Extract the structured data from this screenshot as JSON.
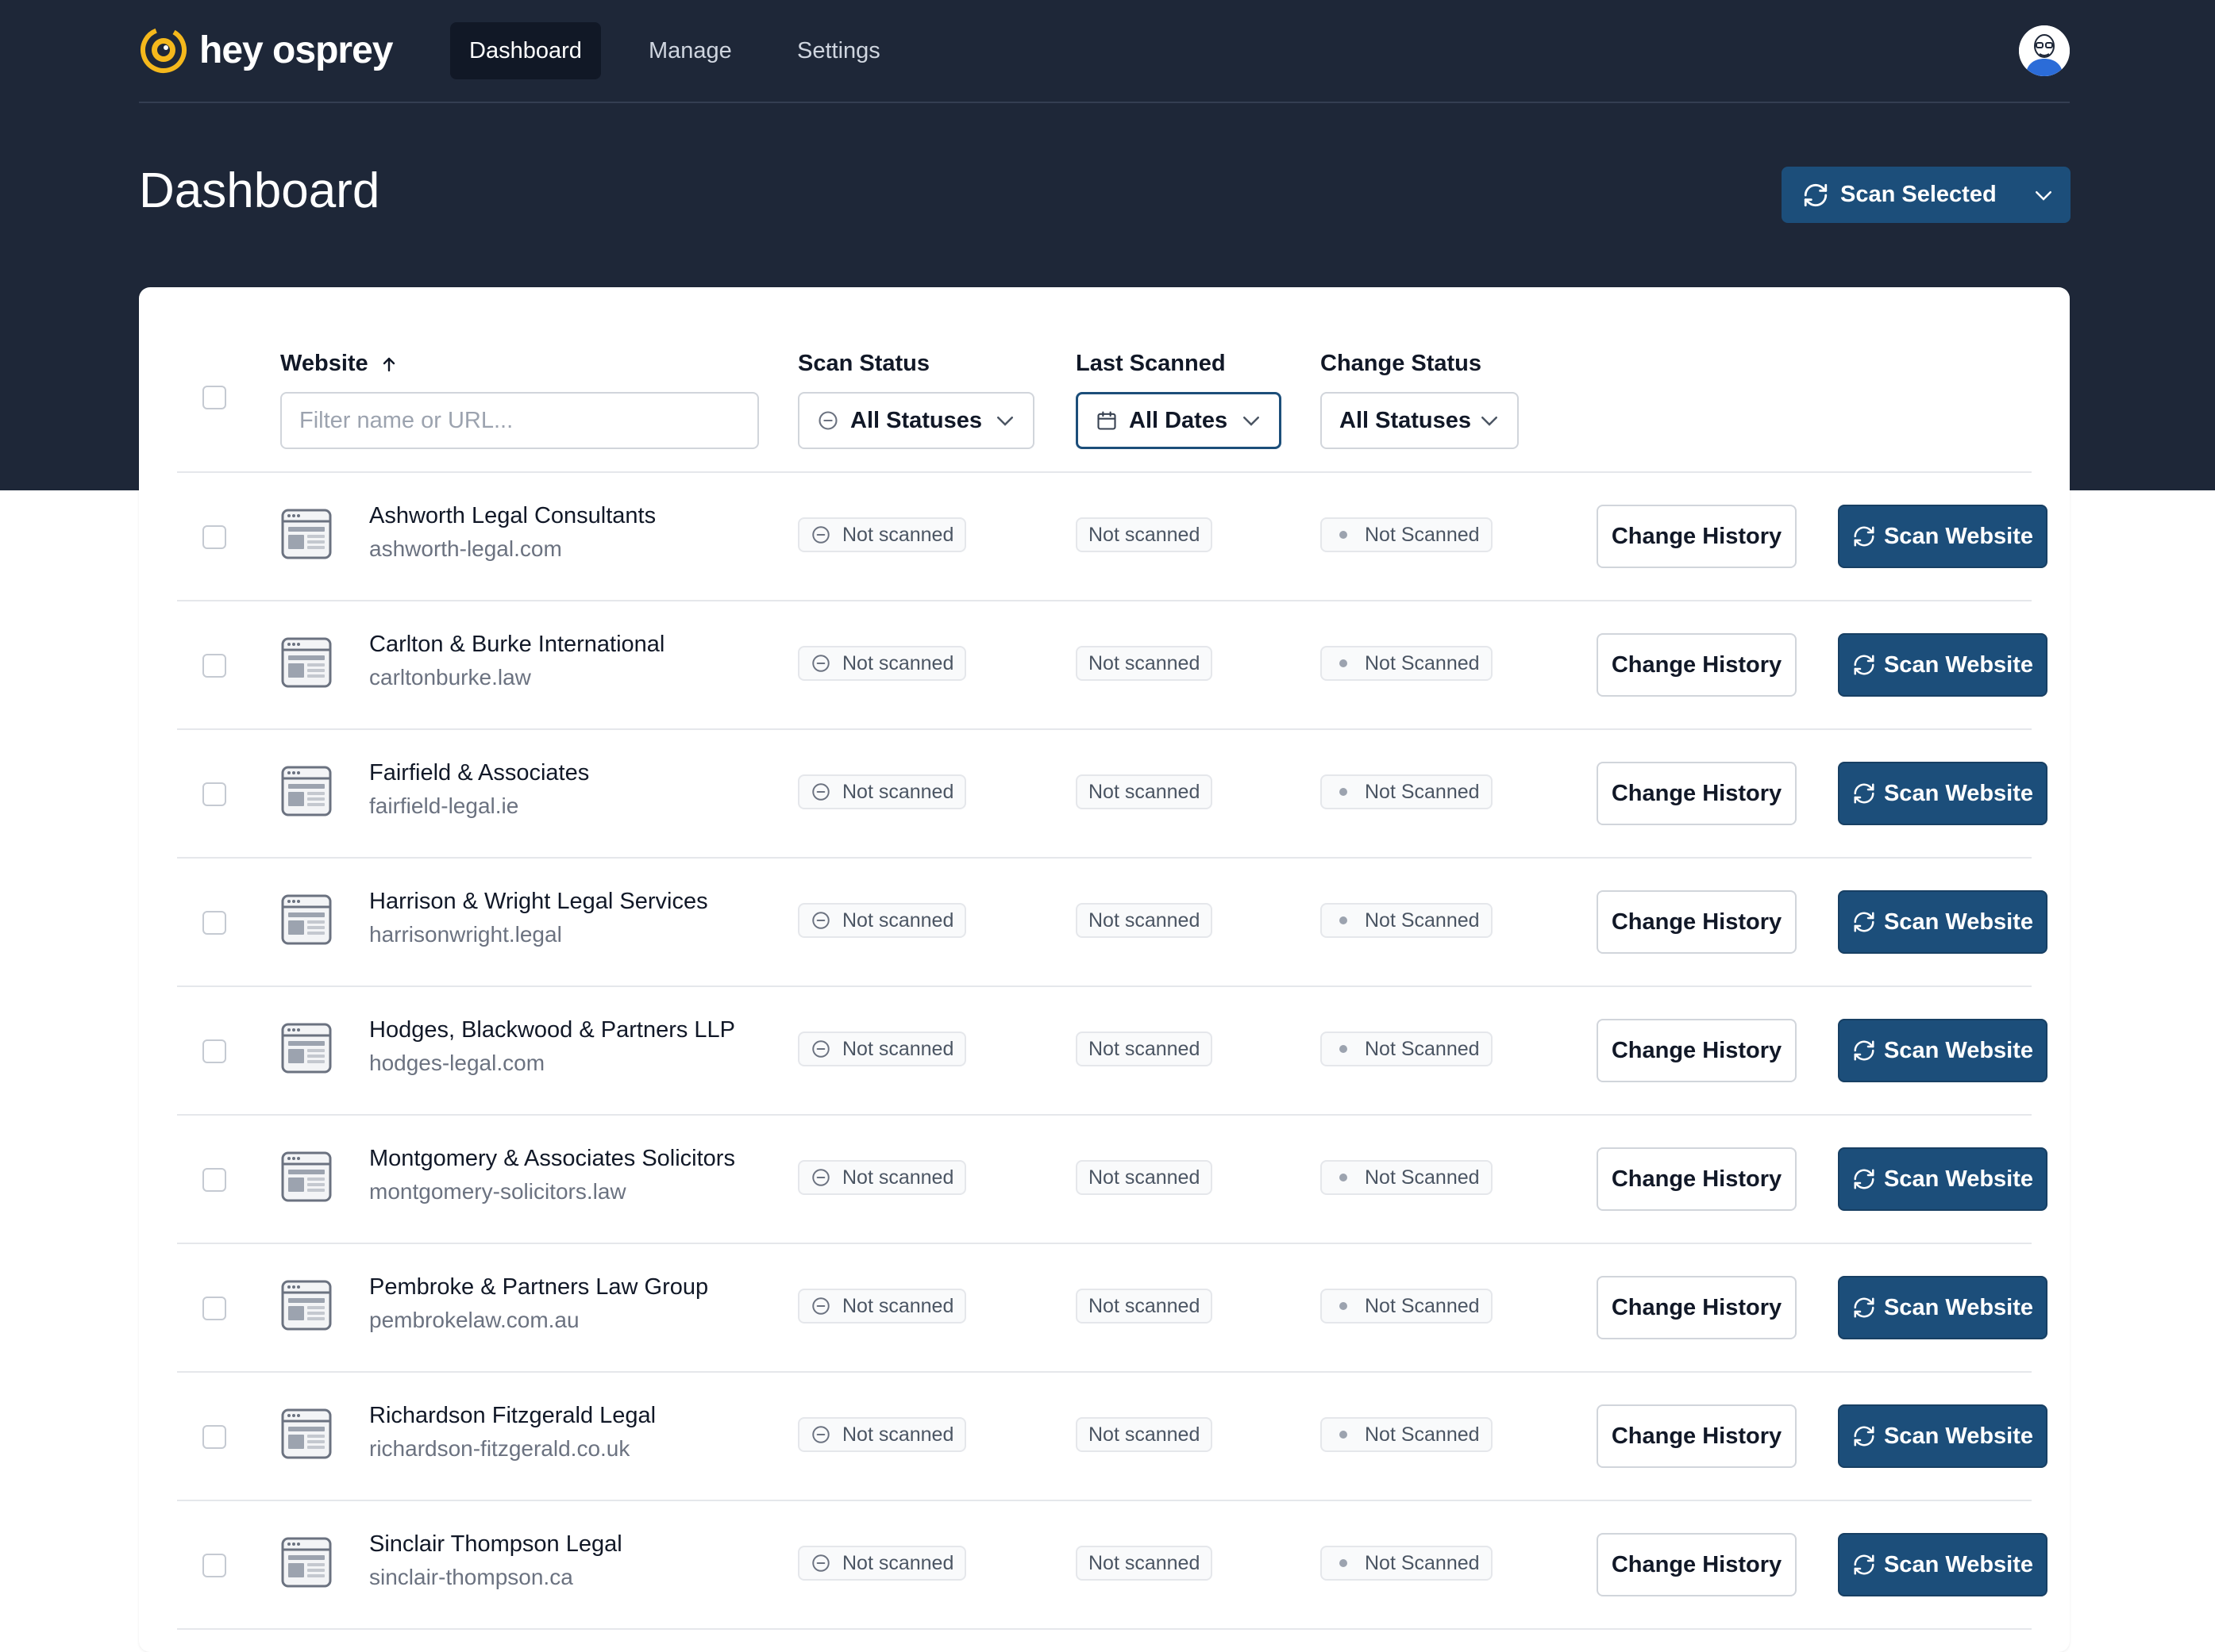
{
  "app": {
    "logo_text": "hey osprey"
  },
  "nav": {
    "items": [
      {
        "label": "Dashboard",
        "active": true
      },
      {
        "label": "Manage",
        "active": false
      },
      {
        "label": "Settings",
        "active": false
      }
    ]
  },
  "page": {
    "title": "Dashboard",
    "scan_selected_label": "Scan Selected"
  },
  "table": {
    "columns": {
      "website": "Website",
      "scan_status": "Scan Status",
      "last_scanned": "Last Scanned",
      "change_status": "Change Status"
    },
    "filters": {
      "website_placeholder": "Filter name or URL...",
      "scan_status": "All Statuses",
      "last_scanned": "All Dates",
      "change_status": "All Statuses"
    },
    "rows": [
      {
        "name": "Ashworth Legal Consultants",
        "url": "ashworth-legal.com",
        "scan_status": "Not scanned",
        "last_scanned": "Not scanned",
        "change_status": "Not Scanned",
        "history_label": "Change History",
        "scan_label": "Scan Website"
      },
      {
        "name": "Carlton & Burke International",
        "url": "carltonburke.law",
        "scan_status": "Not scanned",
        "last_scanned": "Not scanned",
        "change_status": "Not Scanned",
        "history_label": "Change History",
        "scan_label": "Scan Website"
      },
      {
        "name": "Fairfield & Associates",
        "url": "fairfield-legal.ie",
        "scan_status": "Not scanned",
        "last_scanned": "Not scanned",
        "change_status": "Not Scanned",
        "history_label": "Change History",
        "scan_label": "Scan Website"
      },
      {
        "name": "Harrison & Wright Legal Services",
        "url": "harrisonwright.legal",
        "scan_status": "Not scanned",
        "last_scanned": "Not scanned",
        "change_status": "Not Scanned",
        "history_label": "Change History",
        "scan_label": "Scan Website"
      },
      {
        "name": "Hodges, Blackwood & Partners LLP",
        "url": "hodges-legal.com",
        "scan_status": "Not scanned",
        "last_scanned": "Not scanned",
        "change_status": "Not Scanned",
        "history_label": "Change History",
        "scan_label": "Scan Website"
      },
      {
        "name": "Montgomery & Associates Solicitors",
        "url": "montgomery-solicitors.law",
        "scan_status": "Not scanned",
        "last_scanned": "Not scanned",
        "change_status": "Not Scanned",
        "history_label": "Change History",
        "scan_label": "Scan Website"
      },
      {
        "name": "Pembroke & Partners Law Group",
        "url": "pembrokelaw.com.au",
        "scan_status": "Not scanned",
        "last_scanned": "Not scanned",
        "change_status": "Not Scanned",
        "history_label": "Change History",
        "scan_label": "Scan Website"
      },
      {
        "name": "Richardson Fitzgerald Legal",
        "url": "richardson-fitzgerald.co.uk",
        "scan_status": "Not scanned",
        "last_scanned": "Not scanned",
        "change_status": "Not Scanned",
        "history_label": "Change History",
        "scan_label": "Scan Website"
      },
      {
        "name": "Sinclair Thompson Legal",
        "url": "sinclair-thompson.ca",
        "scan_status": "Not scanned",
        "last_scanned": "Not scanned",
        "change_status": "Not Scanned",
        "history_label": "Change History",
        "scan_label": "Scan Website"
      }
    ]
  },
  "icons": {
    "logo": "osprey-eye-icon",
    "sort": "arrow-up-icon",
    "refresh": "refresh-icon",
    "chevron": "chevron-down-icon",
    "calendar": "calendar-icon",
    "status": "minus-circle-icon",
    "website": "browser-window-icon",
    "avatar": "user-avatar"
  },
  "colors": {
    "header_bg": "#1e2738",
    "primary": "#1c4e7a",
    "logo_accent": "#f5b81c",
    "border": "#d1d5db"
  }
}
